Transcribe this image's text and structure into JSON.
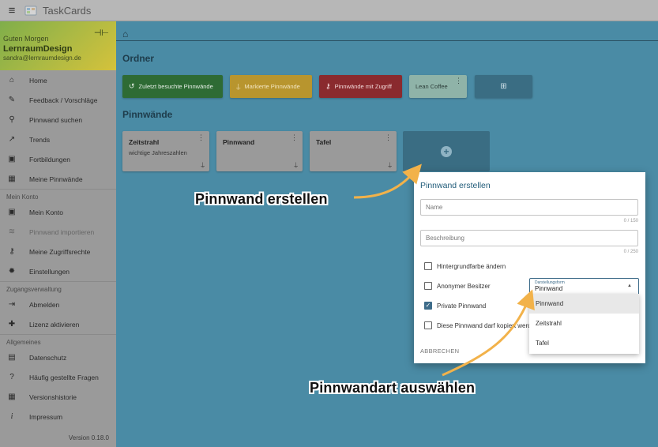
{
  "app": {
    "title": "TaskCards",
    "menu_icon": "hamburger-icon",
    "logo_icon": "taskcards-logo-icon"
  },
  "sidebar": {
    "greeting": "Guten Morgen",
    "username": "LernraumDesign",
    "email": "sandra@lernraumdesign.de",
    "items": [
      {
        "label": "Home",
        "icon": "home-icon",
        "glyph": "⌂"
      },
      {
        "label": "Feedback / Vorschläge",
        "icon": "magic-wand-icon",
        "glyph": "✎"
      },
      {
        "label": "Pinnwand suchen",
        "icon": "search-icon",
        "glyph": "⚲"
      },
      {
        "label": "Trends",
        "icon": "trending-up-icon",
        "glyph": "↗"
      },
      {
        "label": "Fortbildungen",
        "icon": "calendar-icon",
        "glyph": "▣"
      },
      {
        "label": "Meine Pinnwände",
        "icon": "dashboard-icon",
        "glyph": "▦"
      }
    ],
    "section_account": "Mein Konto",
    "account_items": [
      {
        "label": "Mein Konto",
        "icon": "account-box-icon",
        "glyph": "▣"
      },
      {
        "label": "Pinnwand importieren",
        "icon": "database-import-icon",
        "glyph": "≋"
      },
      {
        "label": "Meine Zugriffsrechte",
        "icon": "key-icon",
        "glyph": "⚷"
      },
      {
        "label": "Einstellungen",
        "icon": "gear-icon",
        "glyph": "✹"
      }
    ],
    "section_access": "Zugangsverwaltung",
    "access_items": [
      {
        "label": "Abmelden",
        "icon": "logout-icon",
        "glyph": "⇥"
      },
      {
        "label": "Lizenz aktivieren",
        "icon": "add-user-icon",
        "glyph": "✚"
      }
    ],
    "section_general": "Allgemeines",
    "general_items": [
      {
        "label": "Datenschutz",
        "icon": "document-icon",
        "glyph": "▤"
      },
      {
        "label": "Häufig gestellte Fragen",
        "icon": "question-icon",
        "glyph": "?"
      },
      {
        "label": "Versionshistorie",
        "icon": "history-icon",
        "glyph": "▦"
      },
      {
        "label": "Impressum",
        "icon": "info-icon",
        "glyph": "i"
      }
    ],
    "version": "Version 0.18.0"
  },
  "main": {
    "home_icon": "home-icon",
    "folders_title": "Ordner",
    "folders": [
      {
        "label": "Zuletzt besuchte Pinnwände",
        "icon": "history-icon",
        "glyph": "↺",
        "color": "#2e6b34"
      },
      {
        "label": "Markierte Pinnwände",
        "icon": "pin-icon",
        "glyph": "⍊",
        "color": "#b8952e"
      },
      {
        "label": "Pinnwände mit Zugriff",
        "icon": "key-icon",
        "glyph": "⚷",
        "color": "#8a2a2e"
      },
      {
        "label": "Lean Coffee",
        "icon": "",
        "glyph": "",
        "color": "#8fb3a8"
      }
    ],
    "add_folder_icon": "folder-plus-icon",
    "boards_title": "Pinnwände",
    "boards": [
      {
        "title": "Zeitstrahl",
        "subtitle": "wichtige Jahreszahlen"
      },
      {
        "title": "Pinnwand",
        "subtitle": ""
      },
      {
        "title": "Tafel",
        "subtitle": ""
      }
    ],
    "add_board_icon": "plus-circle-icon"
  },
  "dialog": {
    "title": "Pinnwand erstellen",
    "name_placeholder": "Name",
    "name_counter": "0 / 150",
    "description_placeholder": "Beschreibung",
    "description_counter": "0 / 250",
    "checkboxes": [
      {
        "label": "Hintergrundfarbe ändern",
        "checked": false
      },
      {
        "label": "Anonymer Besitzer",
        "checked": false
      },
      {
        "label": "Private Pinnwand",
        "checked": true
      },
      {
        "label": "Diese Pinnwand darf kopiert werden",
        "checked": false
      }
    ],
    "select_label": "Darstellungsform",
    "select_value": "Pinnwand",
    "cancel_label": "ABBRECHEN",
    "options": [
      "Pinnwand",
      "Zeitstrahl",
      "Tafel"
    ]
  },
  "annotations": {
    "create_board": "Pinnwand erstellen",
    "choose_type": "Pinnwandart auswählen",
    "arrow_color": "#f2b24a"
  }
}
